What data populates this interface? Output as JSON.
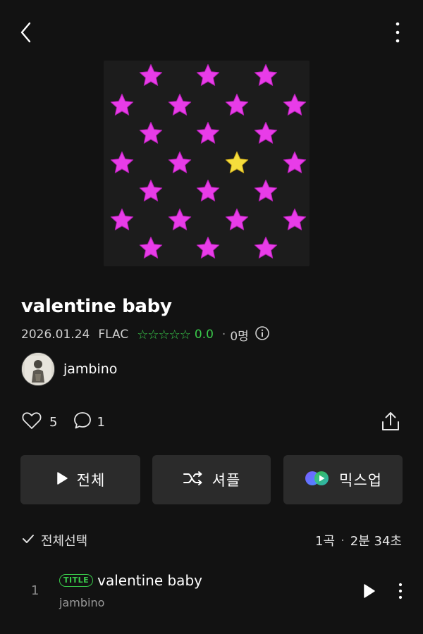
{
  "header": {
    "back_icon": "chevron-left-icon",
    "more_icon": "more-vertical-icon"
  },
  "cover": {
    "background": "#1c1c1c",
    "star_color": "#e83ce8",
    "highlight_star_color": "#f5dd3c",
    "rows": 7,
    "columns": 7
  },
  "album": {
    "title": "valentine baby",
    "release_date": "2026.01.24",
    "format": "FLAC",
    "stars_display": "☆☆☆☆☆",
    "rating": "0.0",
    "rater_count": "0명",
    "artist": "jambino"
  },
  "social": {
    "likes": "5",
    "comments": "1"
  },
  "actions": {
    "play_all": "전체",
    "shuffle": "셔플",
    "mixup": "믹스업"
  },
  "tracklist": {
    "select_all": "전체선택",
    "track_count": "1곡",
    "total_duration": "2분 34초",
    "tracks": [
      {
        "number": "1",
        "badge": "TITLE",
        "title": "valentine baby",
        "artist": "jambino"
      }
    ]
  },
  "colors": {
    "accent": "#39c94a",
    "background": "#121212",
    "button": "#2b2b2b"
  }
}
